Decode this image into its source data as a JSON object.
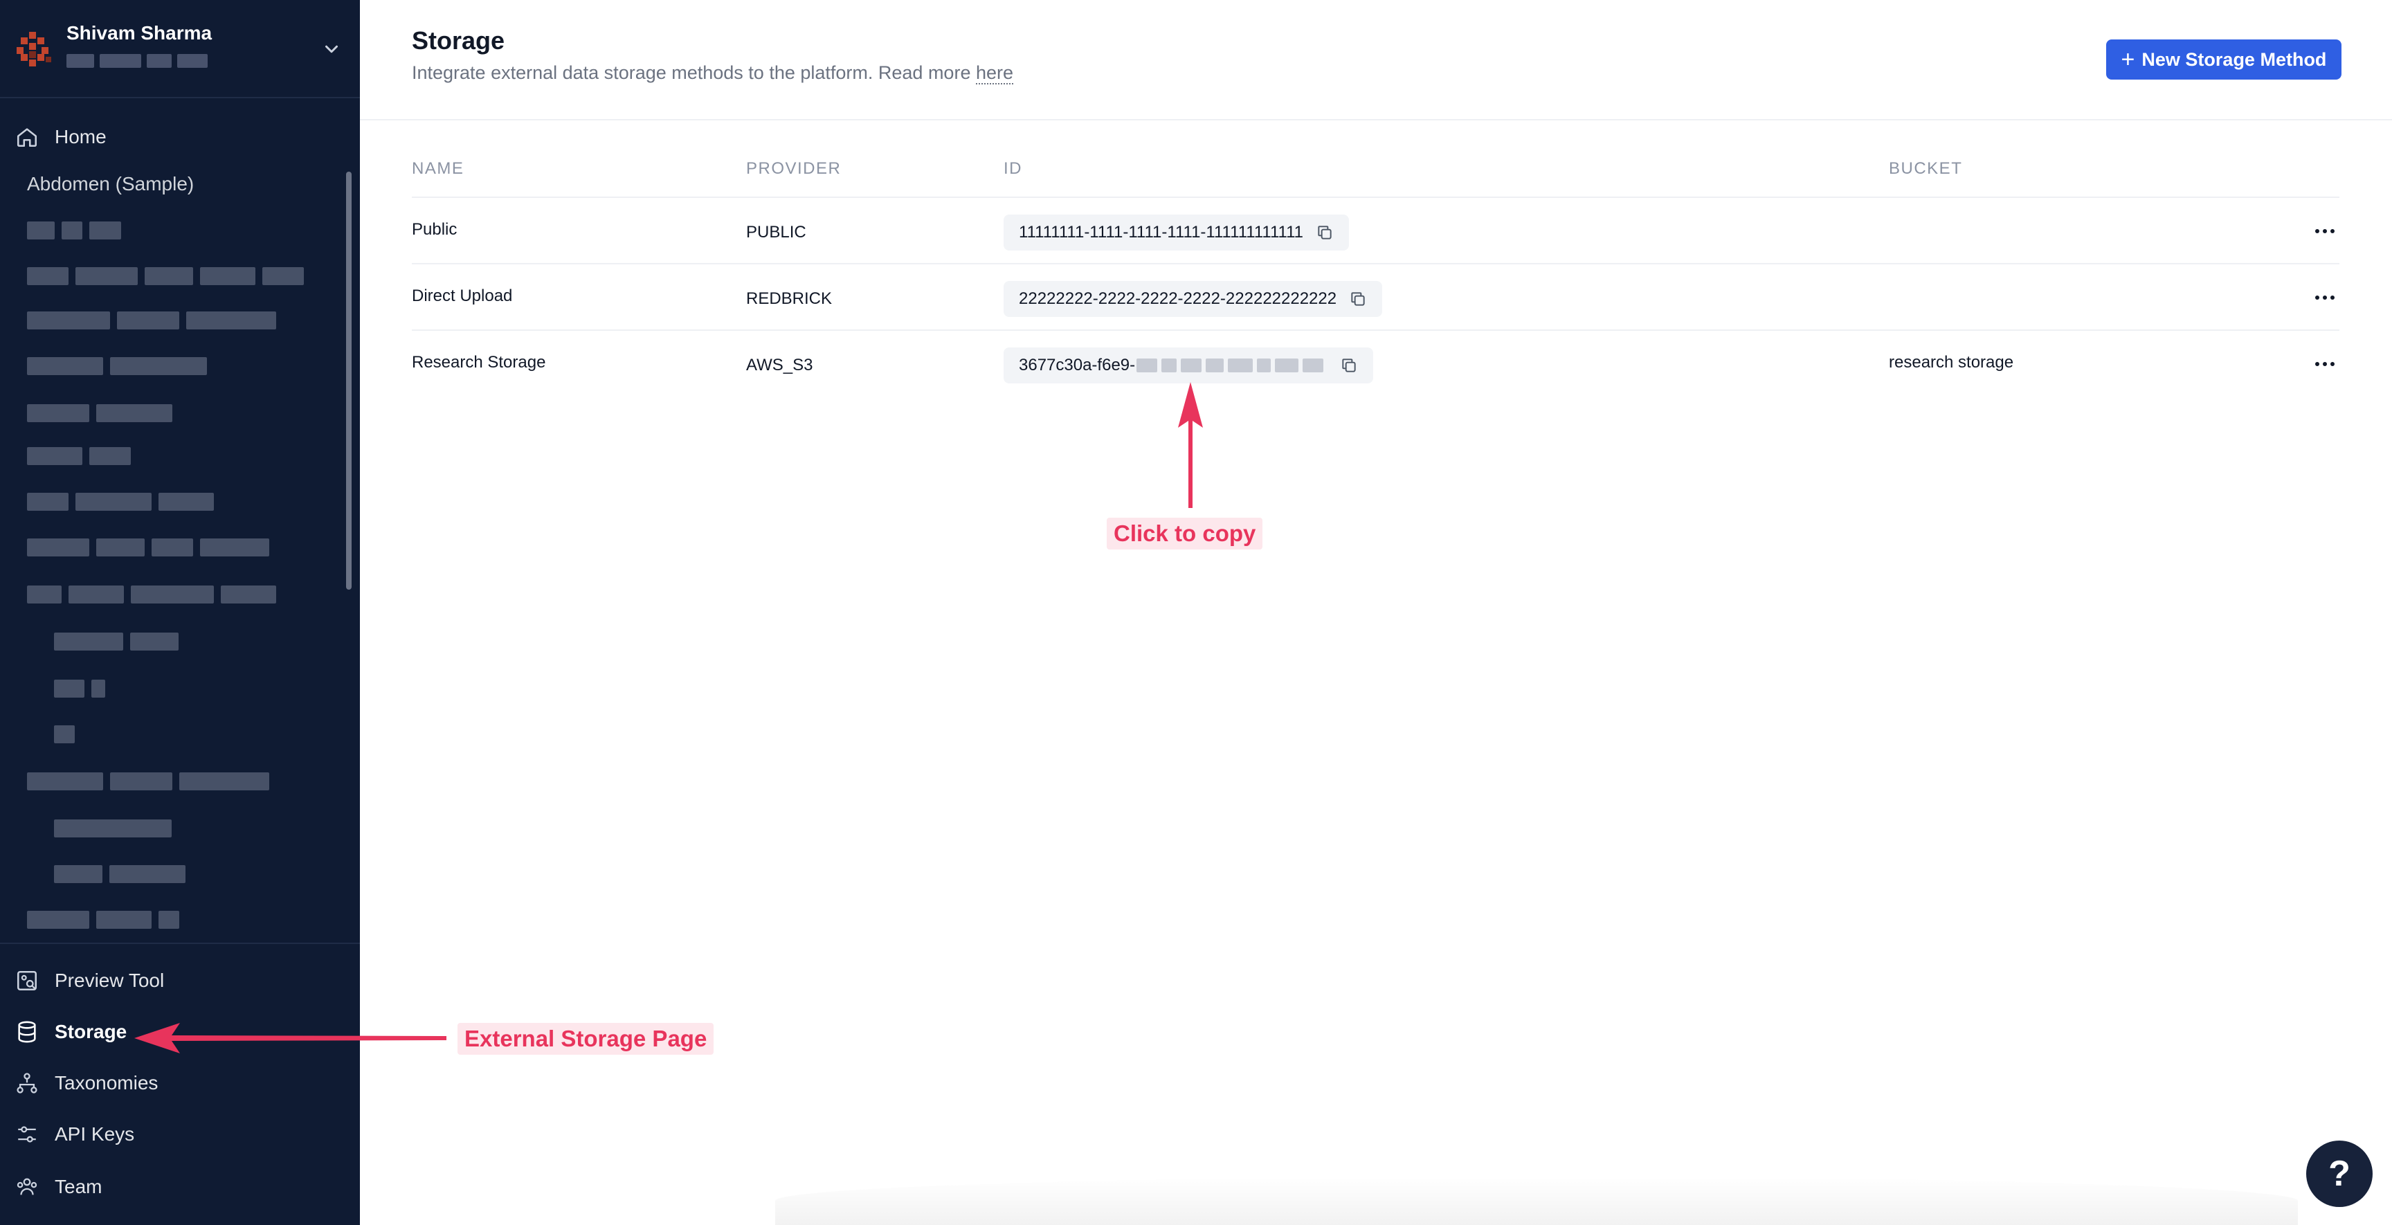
{
  "sidebar": {
    "org_name": "Shivam Sharma",
    "nav_top": {
      "home": "Home"
    },
    "project_title": "Abdomen (Sample)",
    "nav_bottom": {
      "preview_tool": "Preview Tool",
      "storage": "Storage",
      "taxonomies": "Taxonomies",
      "api_keys": "API Keys",
      "team": "Team"
    }
  },
  "header": {
    "title": "Storage",
    "description": "Integrate external data storage methods to the platform. Read more",
    "link_text": "here",
    "new_button": "New Storage Method"
  },
  "table": {
    "columns": [
      "NAME",
      "PROVIDER",
      "ID",
      "BUCKET"
    ],
    "rows": [
      {
        "name": "Public",
        "provider": "PUBLIC",
        "id": "11111111-1111-1111-1111-111111111111",
        "bucket": ""
      },
      {
        "name": "Direct Upload",
        "provider": "REDBRICK",
        "id": "22222222-2222-2222-2222-222222222222",
        "bucket": ""
      },
      {
        "name": "Research Storage",
        "provider": "AWS_S3",
        "id": "3677c30a-f6e9-",
        "bucket": "research storage"
      }
    ]
  },
  "annotations": {
    "copy": "Click to copy",
    "storage_page": "External Storage Page"
  },
  "help": {
    "label": "?"
  },
  "colors": {
    "sidebar_bg": "#0f1b33",
    "accent": "#2f5fe3",
    "annotation": "#e8345c"
  }
}
